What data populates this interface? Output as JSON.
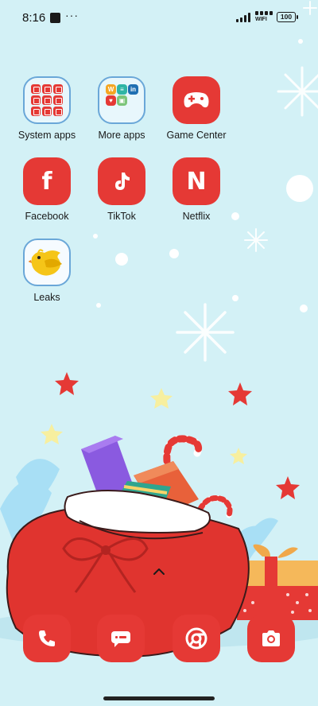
{
  "status_bar": {
    "time": "8:16",
    "dots": "···",
    "wifi_label": "WIFI",
    "battery": "100",
    "notification_icon": "square-notification-icon"
  },
  "apps": [
    {
      "label": "System apps",
      "type": "folder"
    },
    {
      "label": "More apps",
      "type": "folder"
    },
    {
      "label": "Game Center",
      "icon": "gamepad-icon"
    },
    {
      "label": "Facebook",
      "icon_letter": "f"
    },
    {
      "label": "TikTok",
      "icon": "tiktok-note-icon"
    },
    {
      "label": "Netflix",
      "icon_letter": "N"
    },
    {
      "label": "Leaks",
      "icon": "yellow-bird-icon"
    }
  ],
  "more_apps_minis": [
    "W",
    "≡",
    "in",
    "♥",
    "▣"
  ],
  "dock": [
    {
      "name": "phone",
      "icon": "phone-icon"
    },
    {
      "name": "messages",
      "icon": "message-icon"
    },
    {
      "name": "browser",
      "icon": "chrome-icon"
    },
    {
      "name": "camera",
      "icon": "camera-icon"
    }
  ],
  "colors": {
    "accent_red": "#e53935",
    "background": "#d3f1f6",
    "folder_border": "#6aa7d8"
  }
}
